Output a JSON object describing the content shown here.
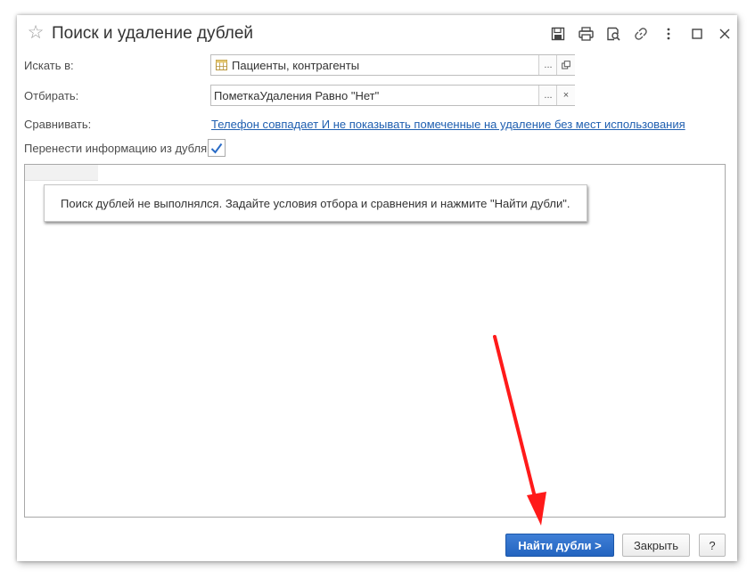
{
  "window": {
    "title": "Поиск и удаление дублей",
    "title_icons": [
      "star-icon",
      "save-icon",
      "print-icon",
      "preview-icon",
      "link-icon",
      "more-icon",
      "maximize-icon",
      "close-icon"
    ]
  },
  "form": {
    "search_in_label": "Искать в:",
    "search_in_value": "Пациенты, контрагенты",
    "search_in_select": "...",
    "filter_label": "Отбирать:",
    "filter_value": "ПометкаУдаления Равно \"Нет\"",
    "filter_select": "...",
    "filter_clear": "×",
    "compare_label": "Сравнивать:",
    "compare_link": "Телефон совпадает И не показывать помеченные на удаление без мест использования",
    "transfer_label": "Перенести информацию из дубля:",
    "transfer_checked": true
  },
  "results": {
    "message": "Поиск дублей не выполнялся.  Задайте условия отбора и сравнения и нажмите \"Найти дубли\"."
  },
  "footer": {
    "find_button": "Найти дубли >",
    "close_button": "Закрыть",
    "help_button": "?"
  },
  "colors": {
    "primary_button": "#2a6cc7",
    "link": "#1f5fb0",
    "annotation_arrow": "#ff1a1a",
    "checkbox_check": "#2a6cc7"
  }
}
